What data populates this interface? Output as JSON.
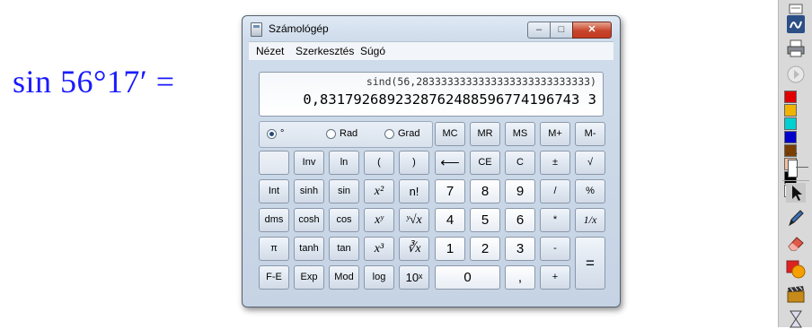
{
  "formula": "sin 56°17′ =",
  "window": {
    "title": "Számológép",
    "menu": [
      "Nézet",
      "Szerkesztés",
      "Súgó"
    ],
    "controls": {
      "minimize": "–",
      "maximize": "□",
      "close": "✕"
    }
  },
  "display": {
    "expression": "sind(56,2833333333333333333333333333)",
    "result": "0,8317926892328762488596774196743 3"
  },
  "angle_modes": {
    "selected": "degree",
    "options": [
      {
        "id": "degree",
        "label": "°"
      },
      {
        "id": "radian",
        "label": "Rad"
      },
      {
        "id": "gradian",
        "label": "Grad"
      }
    ]
  },
  "keys": {
    "mc": "MC",
    "mr": "MR",
    "ms": "MS",
    "mplus": "M+",
    "mminus": "M-",
    "inv": "Inv",
    "ln": "ln",
    "lparen": "(",
    "rparen": ")",
    "backspace": "⟵",
    "ce": "CE",
    "c": "C",
    "plusminus": "±",
    "sqrt": "√",
    "int": "Int",
    "sinh": "sinh",
    "sin": "sin",
    "sq": "x²",
    "fact": "n!",
    "d7": "7",
    "d8": "8",
    "d9": "9",
    "div": "/",
    "pct": "%",
    "dms": "dms",
    "cosh": "cosh",
    "cos": "cos",
    "pow": "xʸ",
    "yroot": "ʸ√x",
    "d4": "4",
    "d5": "5",
    "d6": "6",
    "mul": "*",
    "recip": "1/x",
    "pi": "π",
    "tanh": "tanh",
    "tan": "tan",
    "cube": "x³",
    "croot": "∛x",
    "d1": "1",
    "d2": "2",
    "d3": "3",
    "sub": "-",
    "eq": "=",
    "fe": "F-E",
    "exp": "Exp",
    "mod": "Mod",
    "log": "log",
    "tenx": "10ˣ",
    "d0": "0",
    "dot": ",",
    "add": "+"
  },
  "toolbar": {
    "colors": [
      "#e00000",
      "#f0b400",
      "#00d0d0",
      "#0000cc",
      "#7a3e00",
      "#f0c0a0",
      "#000000",
      "#ffffff"
    ]
  }
}
